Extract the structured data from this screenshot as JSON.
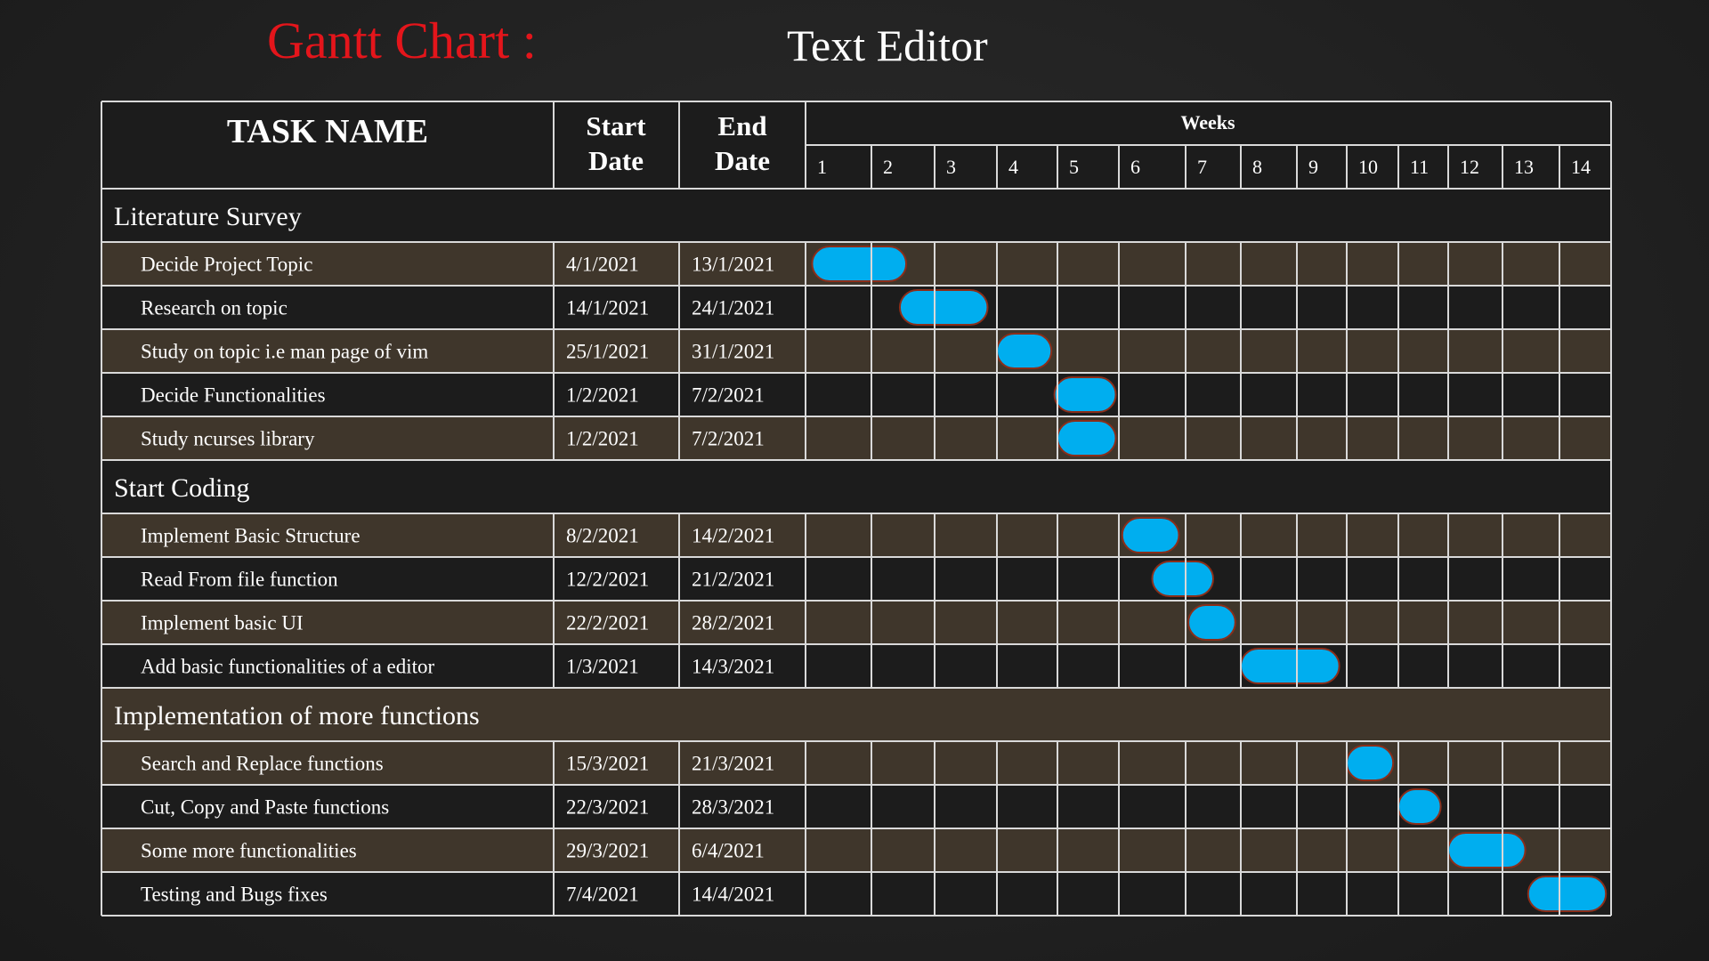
{
  "slide": {
    "title": "Gantt Chart :",
    "subtitle": "Text Editor"
  },
  "colors": {
    "title": "#e4151b",
    "row_brown": "#3f362b",
    "row_dark": "#1c1c1c",
    "grid": "#d9d9d9",
    "bar_fill": "#00aeef",
    "bar_outline": "#8b2e1a"
  },
  "chart_data": {
    "type": "gantt",
    "header": {
      "task_col": "TASK   NAME",
      "start_col": [
        "Start",
        "Date"
      ],
      "end_col": [
        "End",
        "Date"
      ],
      "weeks_label": "Weeks"
    },
    "weeks": [
      "1",
      "2",
      "3",
      "4",
      "5",
      "6",
      "7",
      "8",
      "9",
      "10",
      "11",
      "12",
      "13",
      "14"
    ],
    "rows": [
      {
        "kind": "phase",
        "name": "Literature Survey"
      },
      {
        "kind": "task",
        "name": "Decide Project Topic",
        "start": "4/1/2021",
        "end": "13/1/2021",
        "bar": [
          1.1,
          2.55
        ]
      },
      {
        "kind": "task",
        "name": "Research on topic",
        "start": "14/1/2021",
        "end": "24/1/2021",
        "bar": [
          2.45,
          3.85
        ]
      },
      {
        "kind": "task",
        "name": "Study on topic i.e man page of vim",
        "start": "25/1/2021",
        "end": "31/1/2021",
        "bar": [
          4.0,
          4.9
        ]
      },
      {
        "kind": "task",
        "name": "Decide Functionalities",
        "start": "1/2/2021",
        "end": "7/2/2021",
        "bar": [
          4.95,
          5.95
        ]
      },
      {
        "kind": "task",
        "name": "Study ncurses library",
        "start": "1/2/2021",
        "end": "7/2/2021",
        "bar": [
          5.0,
          5.95
        ]
      },
      {
        "kind": "phase",
        "name": "Start Coding"
      },
      {
        "kind": "task",
        "name": "Implement Basic Structure",
        "start": "8/2/2021",
        "end": "14/2/2021",
        "bar": [
          6.05,
          6.9
        ]
      },
      {
        "kind": "task",
        "name": "Read From file function",
        "start": "12/2/2021",
        "end": "21/2/2021",
        "bar": [
          6.5,
          7.5
        ]
      },
      {
        "kind": "task",
        "name": "Implement basic UI",
        "start": "22/2/2021",
        "end": "28/2/2021",
        "bar": [
          7.05,
          7.9
        ]
      },
      {
        "kind": "task",
        "name": "Add basic functionalities of a editor",
        "start": "1/3/2021",
        "end": "14/3/2021",
        "bar": [
          8.0,
          9.85
        ]
      },
      {
        "kind": "phase",
        "name": "Implementation of more functions"
      },
      {
        "kind": "task",
        "name": "Search and Replace functions",
        "start": "15/3/2021",
        "end": "21/3/2021",
        "bar": [
          10.0,
          10.9
        ]
      },
      {
        "kind": "task",
        "name": "Cut, Copy and Paste functions",
        "start": "22/3/2021",
        "end": "28/3/2021",
        "bar": [
          11.0,
          11.85
        ]
      },
      {
        "kind": "task",
        "name": "Some more functionalities",
        "start": "29/3/2021",
        "end": "6/4/2021",
        "bar": [
          12.0,
          13.4
        ]
      },
      {
        "kind": "task",
        "name": "Testing and Bugs fixes",
        "start": "7/4/2021",
        "end": "14/4/2021",
        "bar": [
          13.45,
          14.9
        ]
      }
    ]
  }
}
